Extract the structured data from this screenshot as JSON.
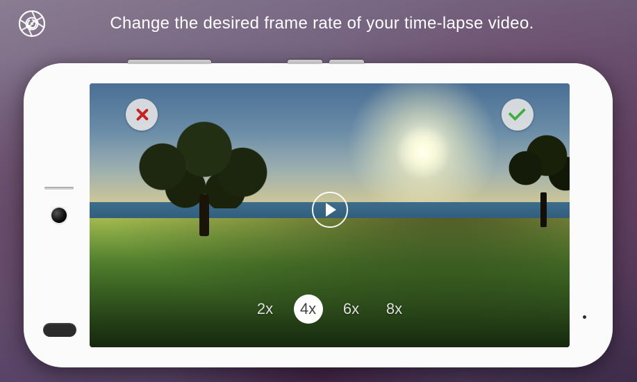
{
  "header": {
    "instruction": "Change the desired frame rate of your time-lapse video."
  },
  "controls": {
    "cancel_icon": "close-icon",
    "confirm_icon": "check-icon",
    "play_icon": "play-icon"
  },
  "speed": {
    "options": [
      "2x",
      "4x",
      "6x",
      "8x"
    ],
    "selected": "4x"
  },
  "colors": {
    "cancel": "#c62020",
    "confirm": "#3fae3f",
    "overlay_button_bg": "#e6e6e6"
  }
}
